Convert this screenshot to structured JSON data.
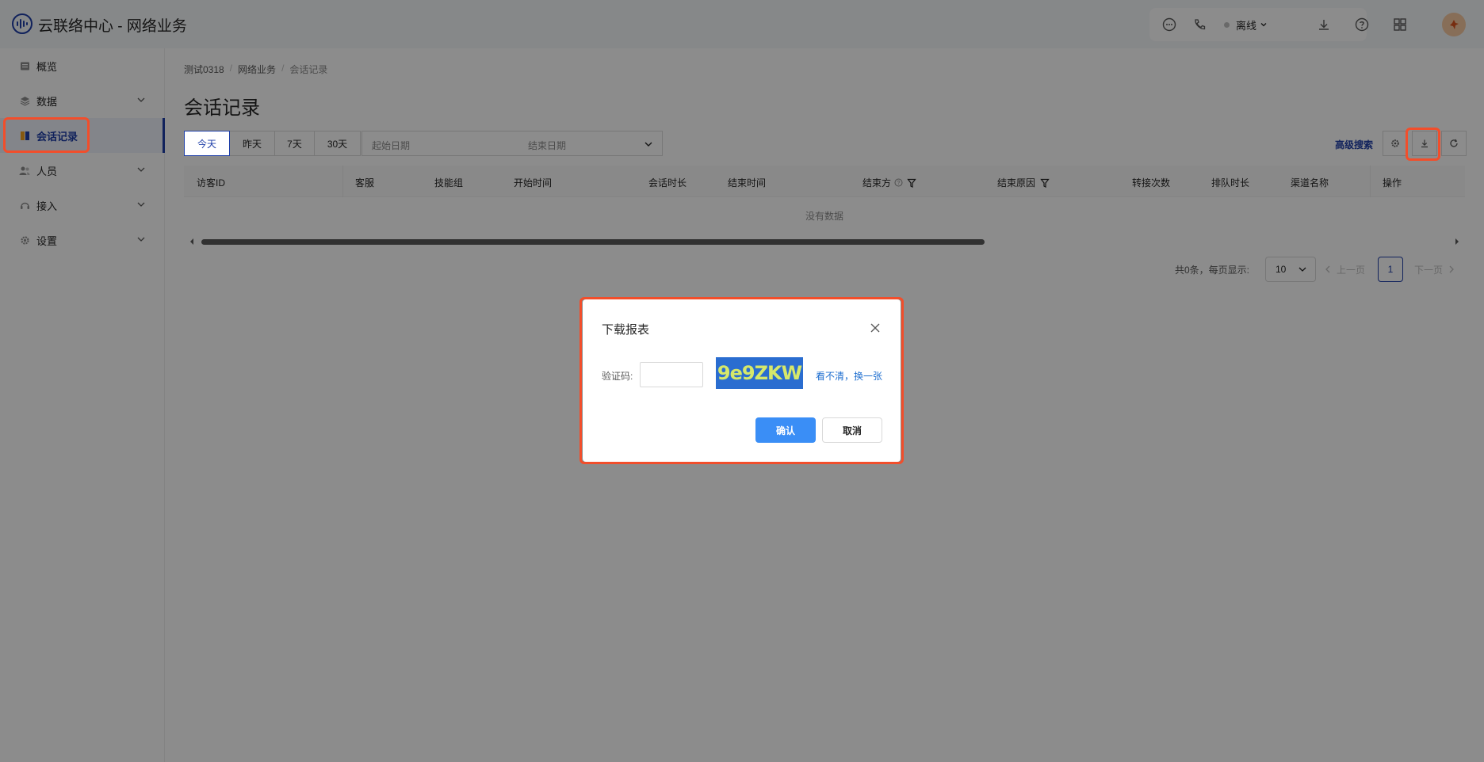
{
  "header": {
    "title": "云联络中心 - 网络业务",
    "status": "离线",
    "icons": [
      "chat-icon",
      "phone-icon",
      "download-icon",
      "help-icon",
      "grid-icon"
    ]
  },
  "sidebar": {
    "items": [
      {
        "label": "概览",
        "icon": "overview-icon"
      },
      {
        "label": "数据",
        "icon": "layers-icon"
      },
      {
        "label": "会话记录",
        "icon": "record-icon",
        "active": true
      },
      {
        "label": "人员",
        "icon": "people-icon"
      },
      {
        "label": "接入",
        "icon": "headset-icon"
      },
      {
        "label": "设置",
        "icon": "gear-icon"
      }
    ]
  },
  "breadcrumb": [
    "测试0318",
    "网络业务",
    "会话记录"
  ],
  "page": {
    "title": "会话记录",
    "ranges": [
      "今天",
      "昨天",
      "7天",
      "30天"
    ],
    "date_start_placeholder": "起始日期",
    "date_end_placeholder": "结束日期",
    "advanced_search": "高级搜索"
  },
  "table": {
    "columns": [
      "访客ID",
      "客服",
      "技能组",
      "开始时间",
      "会话时长",
      "结束时间",
      "结束方",
      "结束原因",
      "转接次数",
      "排队时长",
      "渠道名称",
      "操作"
    ],
    "empty_text": "没有数据"
  },
  "pagination": {
    "summary": "共0条，每页显示:",
    "page_size": "10",
    "prev": "上一页",
    "current": "1",
    "next": "下一页"
  },
  "modal": {
    "title": "下载报表",
    "captcha_label": "验证码:",
    "captcha_value": "",
    "captcha_text": "9e9ZKW",
    "refresh_link": "看不清，换一张",
    "confirm": "确认",
    "cancel": "取消"
  },
  "colors": {
    "accent": "#1f3fa8",
    "primary_button": "#3a8ef6",
    "annotation": "#f24e2b"
  }
}
